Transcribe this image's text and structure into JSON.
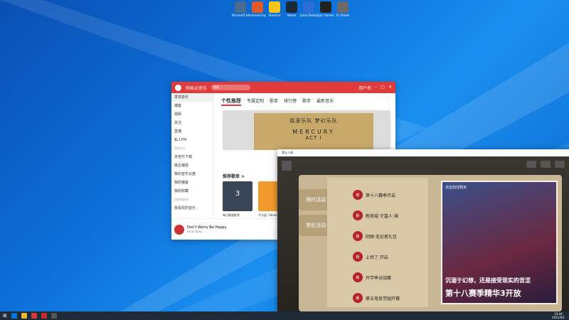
{
  "desktop": {
    "icons": [
      {
        "label": "Microsoft Edge",
        "color": "#4a6c8f"
      },
      {
        "label": "Internet Explorer",
        "color": "#e05a2a"
      },
      {
        "label": "Shortcut",
        "color": "#f5c518"
      },
      {
        "label": "Steam",
        "color": "#1b2838"
      },
      {
        "label": "Jump Desktop",
        "color": "#2b6fd6"
      },
      {
        "label": "Epic Games Launcher",
        "color": "#222"
      },
      {
        "label": "FL Studio",
        "color": "#6a6a6a"
      }
    ]
  },
  "music": {
    "title": "网易云音乐",
    "search_placeholder": "搜索",
    "user": "用户名",
    "sidebar": [
      {
        "label": "发现音乐",
        "active": true
      },
      {
        "label": "播客"
      },
      {
        "label": "视频"
      },
      {
        "label": "关注"
      },
      {
        "label": "直播"
      },
      {
        "label": "私人FM"
      },
      {
        "label": "我的音乐",
        "header": true
      },
      {
        "label": "本地与下载"
      },
      {
        "label": "最近播放"
      },
      {
        "label": "我的音乐云盘"
      },
      {
        "label": "我的播客"
      },
      {
        "label": "我的收藏"
      },
      {
        "label": "创建的歌单",
        "header": true
      },
      {
        "label": "我喜欢的音乐"
      }
    ],
    "tabs": [
      "个性推荐",
      "专属定制",
      "歌单",
      "排行榜",
      "歌手",
      "最新音乐"
    ],
    "banner_line1": "摇滚乐队 梦幻乐队",
    "banner_line2": "MERCURY",
    "banner_line3": "ACT I",
    "rec_title": "推荐歌单 >",
    "cards": [
      {
        "label": "每日歌曲推荐",
        "color": "#3a4656",
        "text": "3"
      },
      {
        "label": "今天起, Obama",
        "color": "#f09a2e",
        "text": ""
      }
    ],
    "player": {
      "song": "Don't Worry Be Happy",
      "artist": "Holly Dolly"
    }
  },
  "game": {
    "title": "第五人格",
    "tabs": [
      "限时活动",
      "常驻活动"
    ],
    "events": [
      {
        "badge": "新",
        "text": "第十八赛季开启"
      },
      {
        "badge": "新",
        "text": "新商城 守墓人·渊"
      },
      {
        "badge": "新",
        "text": "阴雨·无论者礼包"
      },
      {
        "badge": "新",
        "text": "上场了 开启"
      },
      {
        "badge": "新",
        "text": "开学季对战赛"
      },
      {
        "badge": "新",
        "text": "第五电竞学园开赛"
      }
    ],
    "poster_head": "点击前往购买",
    "poster_sub": "沉溺于幻想，还是接受现实的苦涩",
    "poster_big": "第十八赛季精华3开放"
  },
  "taskbar": {
    "apps": [
      "#0078d7",
      "#e8b632",
      "#d13a3a",
      "#c02a2a",
      "#555"
    ],
    "time": "19:04",
    "date": "2021/9/1"
  }
}
